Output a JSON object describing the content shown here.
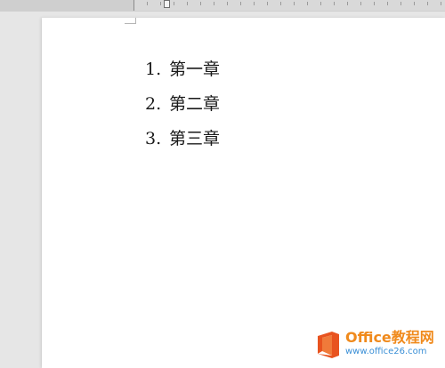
{
  "document": {
    "list_items": [
      {
        "number": "1.",
        "text": "第一章"
      },
      {
        "number": "2.",
        "text": "第二章"
      },
      {
        "number": "3.",
        "text": "第三章"
      }
    ]
  },
  "watermark": {
    "title": "Office教程网",
    "url": "www.office26.com",
    "logo_icon": "office-logo-icon",
    "colors": {
      "title": "#f08a1c",
      "url": "#3a8fd6",
      "logo": "#e8531f"
    }
  },
  "colors": {
    "workspace": "#e6e6e6",
    "page": "#ffffff",
    "text": "#1a1a1a"
  }
}
